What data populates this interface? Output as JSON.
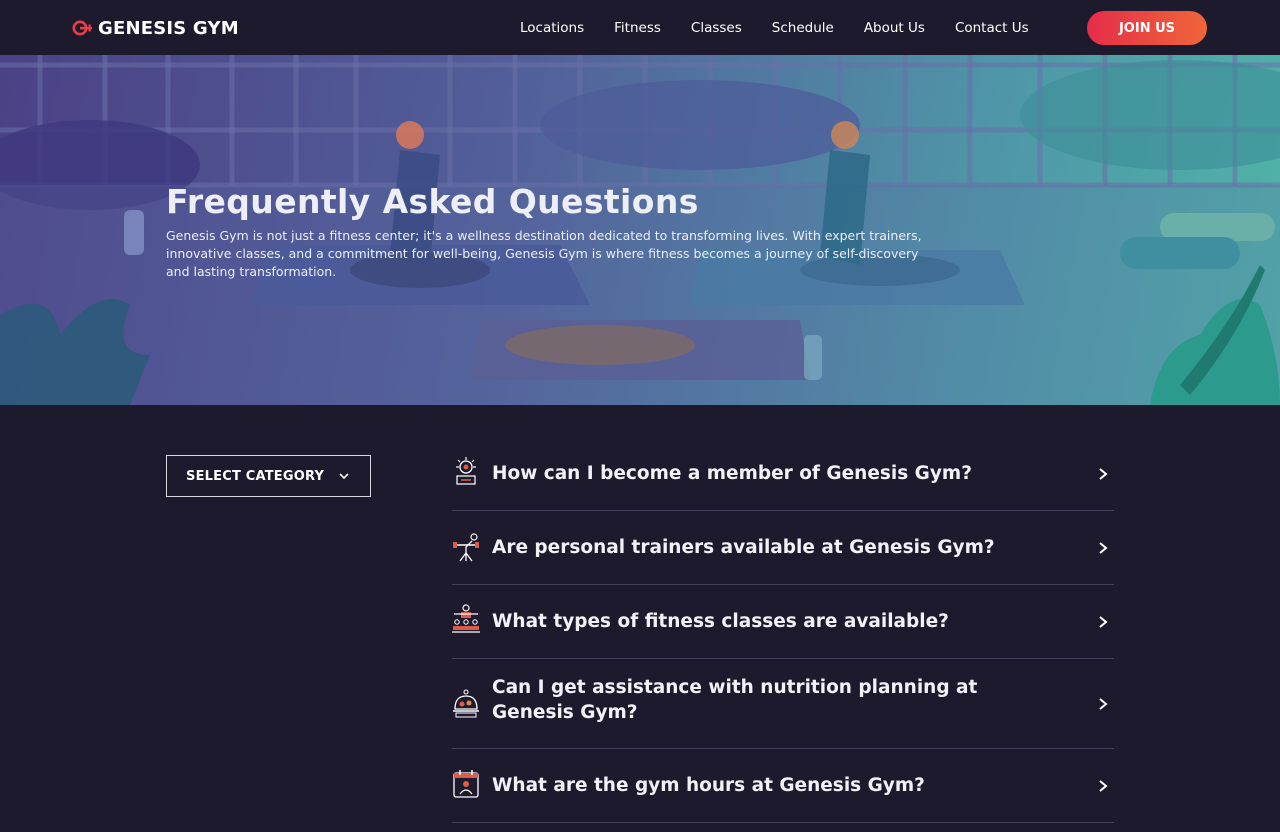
{
  "brand": {
    "name": "GENESIS GYM",
    "logo_icon": "genesis-logo-icon",
    "accent": "#e83e45"
  },
  "nav": {
    "links": [
      "Locations",
      "Fitness",
      "Classes",
      "Schedule",
      "About Us",
      "Contact Us"
    ],
    "cta": "JOIN US"
  },
  "hero": {
    "title": "Frequently Asked Questions",
    "description": "Genesis Gym is not just a fitness center; it's a wellness destination dedicated to transforming lives. With expert trainers, innovative classes, and a commitment for  well-being, Genesis Gym is where fitness becomes a journey of self-discovery and lasting transformation."
  },
  "category": {
    "label": "SELECT CATEGORY",
    "icon": "chevron-down-icon"
  },
  "faq": {
    "items": [
      {
        "question": "How can I become a member of Genesis Gym?",
        "icon": "membership-icon"
      },
      {
        "question": "Are personal trainers available at Genesis Gym?",
        "icon": "trainer-icon"
      },
      {
        "question": "What types of fitness classes are available?",
        "icon": "classes-icon"
      },
      {
        "question": "Can I get assistance with nutrition planning at Genesis Gym?",
        "icon": "nutrition-icon"
      },
      {
        "question": "What are the gym hours at Genesis Gym?",
        "icon": "calendar-icon"
      }
    ],
    "arrow_icon": "chevron-right-icon"
  },
  "colors": {
    "background": "#1e1a2e",
    "divider": "#453f5a",
    "button_gradient_start": "#e52d4a",
    "button_gradient_end": "#f06538"
  }
}
